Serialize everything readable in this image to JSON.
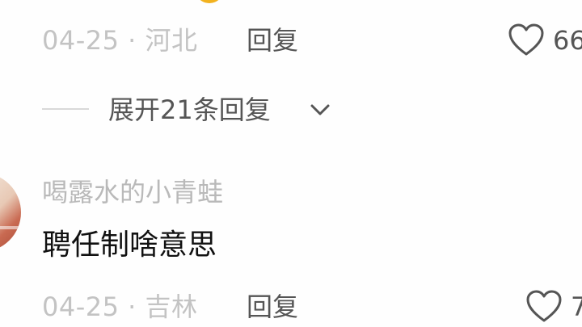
{
  "comments": [
    {
      "date_location": "04-25 · 河北",
      "reply_label": "回复",
      "like_count": "66",
      "expand_replies_label": "展开21条回复"
    },
    {
      "username": "喝露水的小青蛙",
      "text": "聘任制啥意思",
      "date_location": "04-25 · 吉林",
      "reply_label": "回复",
      "like_count": "7"
    }
  ],
  "icons": {
    "like": "heart-outline-icon",
    "expand": "chevron-down-icon"
  },
  "colors": {
    "meta_gray": "#c3c3c3",
    "text_dark": "#555555",
    "comment_black": "#111111"
  }
}
